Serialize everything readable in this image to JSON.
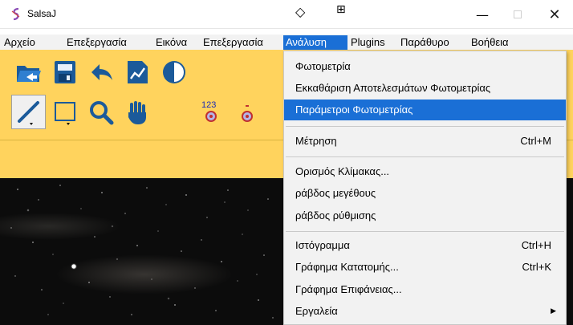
{
  "window": {
    "title": "SalsaJ",
    "titlebar_glyph_1": "◇",
    "titlebar_glyph_2": "⊞",
    "minimize": "—",
    "close": "✕"
  },
  "menubar": {
    "items": [
      {
        "label": "Αρχείο"
      },
      {
        "label": "Επεξεργασία"
      },
      {
        "label": "Εικόνα"
      },
      {
        "label": "Επεξεργασία"
      },
      {
        "label": "Ανάλυση",
        "active": true
      },
      {
        "label": "Plugins"
      },
      {
        "label": "Παράθυρο"
      },
      {
        "label": "Βοήθεια"
      }
    ]
  },
  "toolbar": {
    "row1_icons": [
      "open-icon",
      "save-icon",
      "undo-icon",
      "chart-icon",
      "contrast-icon"
    ],
    "row2_icons": [
      "line-tool-icon",
      "rectangle-tool-icon",
      "magnifier-icon",
      "hand-icon",
      "photometry-numbered-icon",
      "photometry-icon"
    ],
    "numbered_label": "123",
    "accent": "#ffd35d"
  },
  "analysis_menu": {
    "items": [
      {
        "label": "Φωτομετρία",
        "accel": ""
      },
      {
        "label": "Εκκαθάριση Αποτελεσμάτων Φωτομετρίας",
        "accel": ""
      },
      {
        "label": "Παράμετροι Φωτομετρίας",
        "accel": "",
        "highlighted": true
      },
      {
        "label": "Μέτρηση",
        "accel": "Ctrl+M"
      },
      {
        "label": "Ορισμός Κλίμακας...",
        "accel": ""
      },
      {
        "label": "ράβδος μεγέθους",
        "accel": ""
      },
      {
        "label": "ράβδος ρύθμισης",
        "accel": ""
      },
      {
        "label": "Ιστόγραμμα",
        "accel": "Ctrl+H"
      },
      {
        "label": "Γράφημα Κατατομής...",
        "accel": "Ctrl+K"
      },
      {
        "label": "Γράφημα Επιφάνειας...",
        "accel": ""
      },
      {
        "label": "Εργαλεία",
        "accel": "",
        "submenu_arrow": "▶"
      }
    ],
    "highlight_color": "#1a6fd6"
  }
}
